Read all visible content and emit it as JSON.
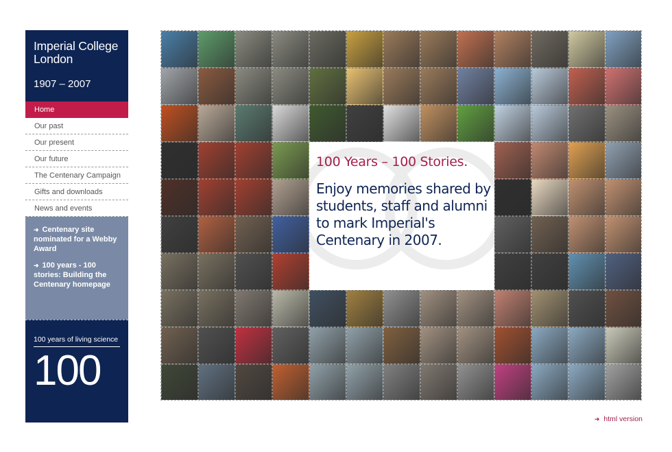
{
  "brand": {
    "name_line1": "Imperial College",
    "name_line2": "London",
    "years": "1907 – 2007"
  },
  "nav": {
    "items": [
      {
        "label": "Home",
        "active": true
      },
      {
        "label": "Our past",
        "active": false
      },
      {
        "label": "Our present",
        "active": false
      },
      {
        "label": "Our future",
        "active": false
      },
      {
        "label": "The Centenary Campaign",
        "active": false
      },
      {
        "label": "Gifts and downloads",
        "active": false
      },
      {
        "label": "News and events",
        "active": false
      }
    ]
  },
  "news": {
    "items": [
      {
        "text": "Centenary site nominated for a Webby Award"
      },
      {
        "text": "100 years - 100 stories: Building the Centenary homepage"
      }
    ]
  },
  "centenary_badge": {
    "tagline": "100 years of living science",
    "number": "100"
  },
  "feature": {
    "headline": "100 Years – 100 Stories.",
    "subtext": "Enjoy memories shared by students, staff and alumni to mark Imperial's Centenary in 2007."
  },
  "footer": {
    "html_version_label": "html version"
  },
  "colors": {
    "navy": "#0e2453",
    "crimson": "#c21d4a",
    "slate": "#7a8aa6"
  },
  "mosaic": {
    "columns": 13,
    "rows": 10,
    "tile_colors": [
      "#4a7fa8",
      "#5d9b6a",
      "#8a8a80",
      "#8a8a80",
      "#6a6a60",
      "#c8a040",
      "#9a7a5a",
      "#9a7a5a",
      "#c07050",
      "#b08060",
      "#706a60",
      "#d0c8a0",
      "#7fa0c0",
      "#a0a4a8",
      "#8a5a40",
      "#8a8a80",
      "#8a8a80",
      "#607040",
      "#e8c070",
      "#9a7a5a",
      "#9a7a5a",
      "#7080a0",
      "#8ab0d0",
      "#b8c8d8",
      "#c06050",
      "#d07070",
      "#c05020",
      "#b8a898",
      "#5a7a70",
      "#d8d8d8",
      "#405a30",
      "#404040",
      "#e0e0e0",
      "#c09060",
      "#60a040",
      "#c0d0e0",
      "#b8c8d8",
      "#707070",
      "#9a9080",
      "#303030",
      "#a04030",
      "#a04030",
      "#7a9a50",
      "#ffffff",
      "#ffffff",
      "#ffffff",
      "#ffffff",
      "#ffffff",
      "#a06050",
      "#c08870",
      "#e0a050",
      "#90a0b0",
      "#503028",
      "#a04030",
      "#a04030",
      "#b0a090",
      "#ffffff",
      "#ffffff",
      "#ffffff",
      "#ffffff",
      "#ffffff",
      "#303030",
      "#e8d8c0",
      "#c09070",
      "#c09070",
      "#404040",
      "#b06040",
      "#706050",
      "#4060a0",
      "#ffffff",
      "#ffffff",
      "#ffffff",
      "#ffffff",
      "#ffffff",
      "#606060",
      "#706050",
      "#c09070",
      "#c09070",
      "#787060",
      "#787060",
      "#505050",
      "#b04030",
      "#ffffff",
      "#ffffff",
      "#ffffff",
      "#ffffff",
      "#ffffff",
      "#404040",
      "#404040",
      "#6090b0",
      "#506080",
      "#787060",
      "#787060",
      "#807870",
      "#b8b8a8",
      "#405060",
      "#a08040",
      "#909090",
      "#a09080",
      "#a09080",
      "#c08070",
      "#a09070",
      "#505050",
      "#705040",
      "#706050",
      "#505050",
      "#c03040",
      "#606060",
      "#90a0a8",
      "#90a0a8",
      "#806040",
      "#a09080",
      "#a09080",
      "#a05030",
      "#8aa8c0",
      "#8aa8c0",
      "#c8c8b8",
      "#404838",
      "#607080",
      "#504840",
      "#c06030",
      "#90a0a8",
      "#90a0a8",
      "#808080",
      "#807870",
      "#909090",
      "#c04080",
      "#8aa8c0",
      "#8aa8c0",
      "#a0a0a0"
    ]
  }
}
